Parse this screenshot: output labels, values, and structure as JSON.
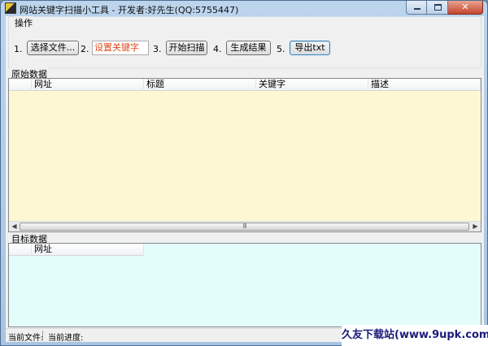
{
  "window": {
    "title": "网站关键字扫描小工具 - 开发者:好先生(QQ:5755447)",
    "min_icon": "minimize-icon",
    "max_icon": "maximize-icon",
    "close_icon": "close-icon",
    "close_glyph": "✕"
  },
  "ops": {
    "label": "操作",
    "steps": [
      {
        "num": "1.",
        "label": "选择文件..."
      },
      {
        "num": "2.",
        "placeholder": "设置关键字"
      },
      {
        "num": "3.",
        "label": "开始扫描"
      },
      {
        "num": "4.",
        "label": "生成结果"
      },
      {
        "num": "5.",
        "label": "导出txt"
      }
    ]
  },
  "source": {
    "label": "原始数据",
    "columns": [
      "网址",
      "标题",
      "关键字",
      "描述"
    ],
    "rows": [],
    "grip": "III",
    "scroll_left": "◀",
    "scroll_right": "▶"
  },
  "target": {
    "label": "目标数据",
    "columns": [
      "网址"
    ],
    "rows": []
  },
  "status": {
    "current_file": "当前文件:",
    "current_progress": "当前进度:"
  },
  "watermark": {
    "text": "久友下载站(www.9upk.com)"
  },
  "colors": {
    "source_bg": "#fdf8d2",
    "target_bg": "#e3fdfb",
    "keyword_placeholder": "#e0471a"
  }
}
